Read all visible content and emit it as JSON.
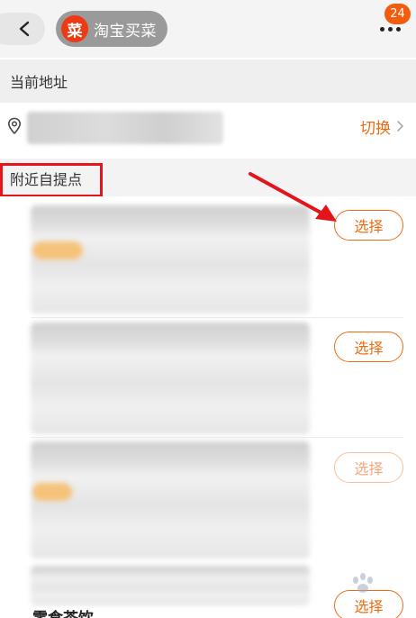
{
  "header": {
    "app_name": "淘宝买菜",
    "logo_char": "菜",
    "badge_count": "24",
    "icons": {
      "back": "chevron-left-icon",
      "more": "more-dots-icon"
    }
  },
  "current_address": {
    "section_title": "当前地址",
    "switch_label": "切换"
  },
  "nearby": {
    "section_title": "附近自提点",
    "items": [
      {
        "select_label": "选择"
      },
      {
        "select_label": "选择"
      },
      {
        "select_label": "选择"
      },
      {
        "select_label": "选择"
      }
    ],
    "bottom_text": "零食茶饮"
  },
  "colors": {
    "accent": "#ec6a10",
    "badge": "#f35b0d",
    "logo": "#ee3a12",
    "annotation": "#e3141a"
  }
}
